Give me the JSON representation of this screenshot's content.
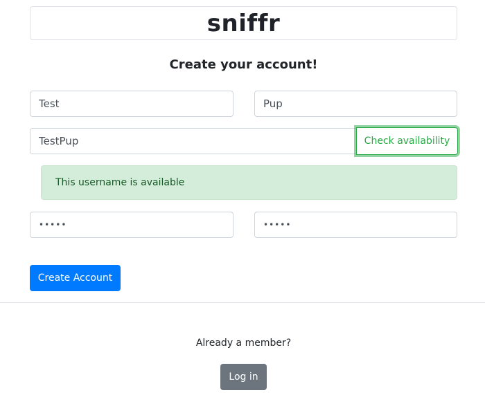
{
  "header": {
    "brand": "sniffr"
  },
  "title": "Create your account!",
  "form": {
    "first_name": "Test",
    "last_name": "Pup",
    "username": "TestPup",
    "check_label": "Check availability",
    "availability_message": "This username is available",
    "password": "•••••",
    "password_confirm": "•••••",
    "submit_label": "Create Account"
  },
  "footer": {
    "prompt": "Already a member?",
    "login_label": "Log in"
  },
  "colors": {
    "primary": "#007bff",
    "success": "#28a745",
    "alert_bg": "#d4edda",
    "secondary": "#6c757d"
  }
}
